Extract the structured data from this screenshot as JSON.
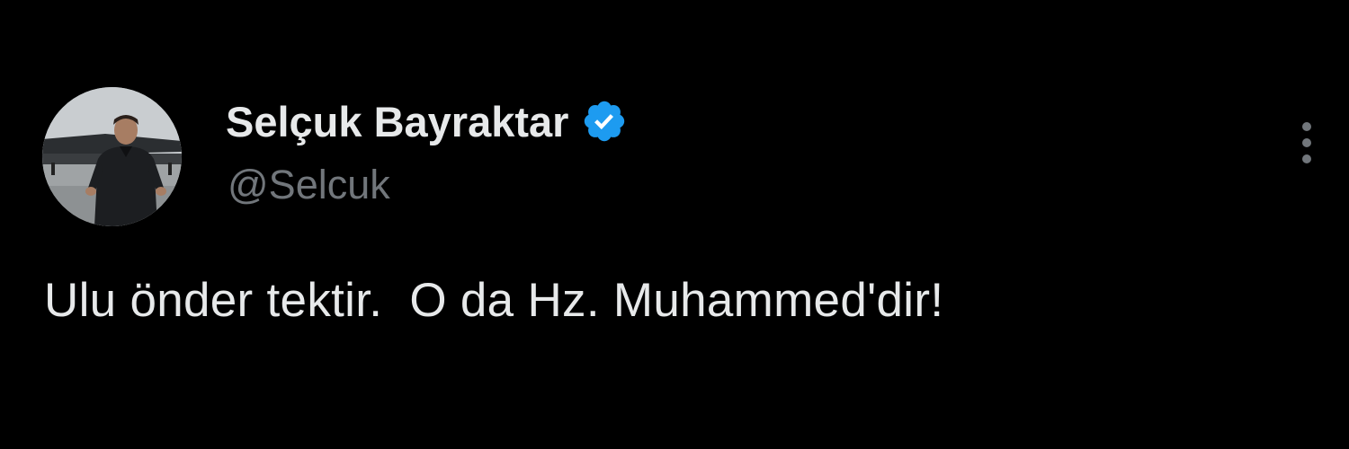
{
  "author": {
    "display_name": "Selçuk Bayraktar",
    "handle": "@Selcuk",
    "verified": true,
    "avatar_icon": "profile-photo"
  },
  "tweet": {
    "text": "Ulu önder tektir.  O da Hz. Muhammed'dir!"
  },
  "actions": {
    "more_icon": "more-vertical-icon"
  },
  "colors": {
    "background": "#000000",
    "primary_text": "#e7e9ea",
    "secondary_text": "#71767b",
    "verified_badge": "#1d9bf0"
  }
}
